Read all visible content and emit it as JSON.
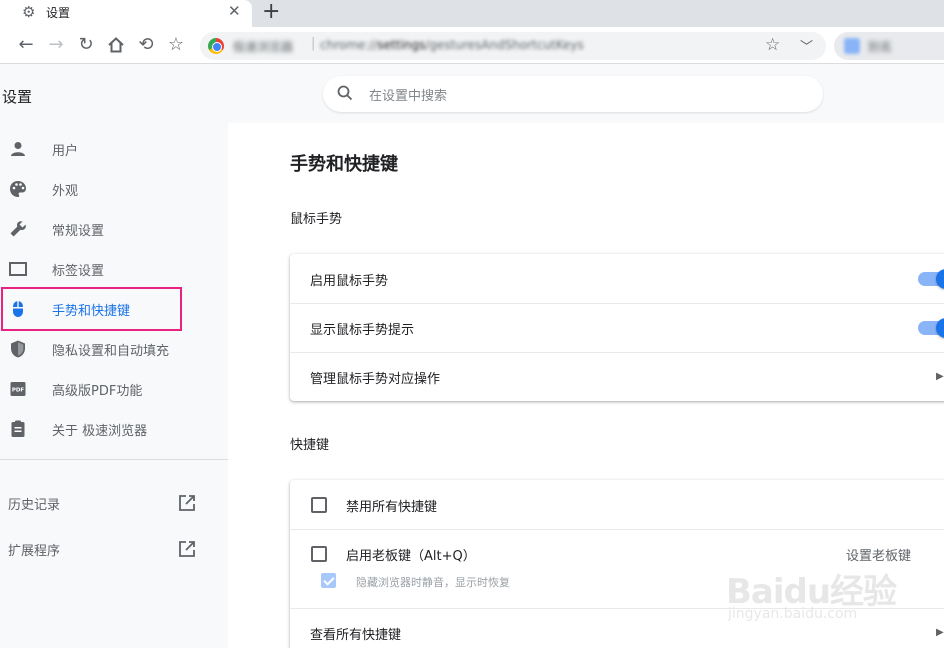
{
  "tab": {
    "title": "设置",
    "icon": "gear-icon"
  },
  "omnibox": {
    "site_name": "极速浏览器",
    "url_scheme": "chrome://",
    "url_host": "settings",
    "url_path": "/gesturesAndShortcutKeys"
  },
  "profile": {
    "name": "别名"
  },
  "header": {
    "title": "设置",
    "search_placeholder": "在设置中搜索"
  },
  "sidebar": {
    "items": [
      {
        "label": "用户",
        "icon": "person-icon"
      },
      {
        "label": "外观",
        "icon": "palette-icon"
      },
      {
        "label": "常规设置",
        "icon": "wrench-icon"
      },
      {
        "label": "标签设置",
        "icon": "tab-icon"
      },
      {
        "label": "手势和快捷键",
        "icon": "mouse-icon",
        "active": true
      },
      {
        "label": "隐私设置和自动填充",
        "icon": "shield-icon"
      },
      {
        "label": "高级版PDF功能",
        "icon": "pdf-icon"
      },
      {
        "label": "关于 极速浏览器",
        "icon": "clipboard-icon"
      }
    ],
    "links": [
      {
        "label": "历史记录",
        "icon": "open-external-icon"
      },
      {
        "label": "扩展程序",
        "icon": "open-external-icon"
      }
    ],
    "highlight_color": "#e8227e"
  },
  "main": {
    "page_title": "手势和快捷键",
    "mouse_section": {
      "title": "鼠标手势",
      "rows": [
        {
          "label": "启用鼠标手势",
          "enabled": true
        },
        {
          "label": "显示鼠标手势提示",
          "enabled": true
        },
        {
          "label": "管理鼠标手势对应操作"
        }
      ]
    },
    "shortcut_section": {
      "title": "快捷键",
      "disable_all": {
        "label": "禁用所有快捷键",
        "checked": false
      },
      "boss_key": {
        "label": "启用老板键（Alt+Q）",
        "checked": false,
        "action": "设置老板键"
      },
      "mute": {
        "label": "隐藏浏览器时静音，显示时恢复",
        "checked": true
      },
      "view_all": {
        "label": "查看所有快捷键"
      }
    }
  },
  "watermark": {
    "text": "Baidu经验",
    "sub": "jingyan.baidu.com"
  },
  "colors": {
    "accent": "#1a73e8",
    "toggle_track": "#8ab4f8"
  }
}
